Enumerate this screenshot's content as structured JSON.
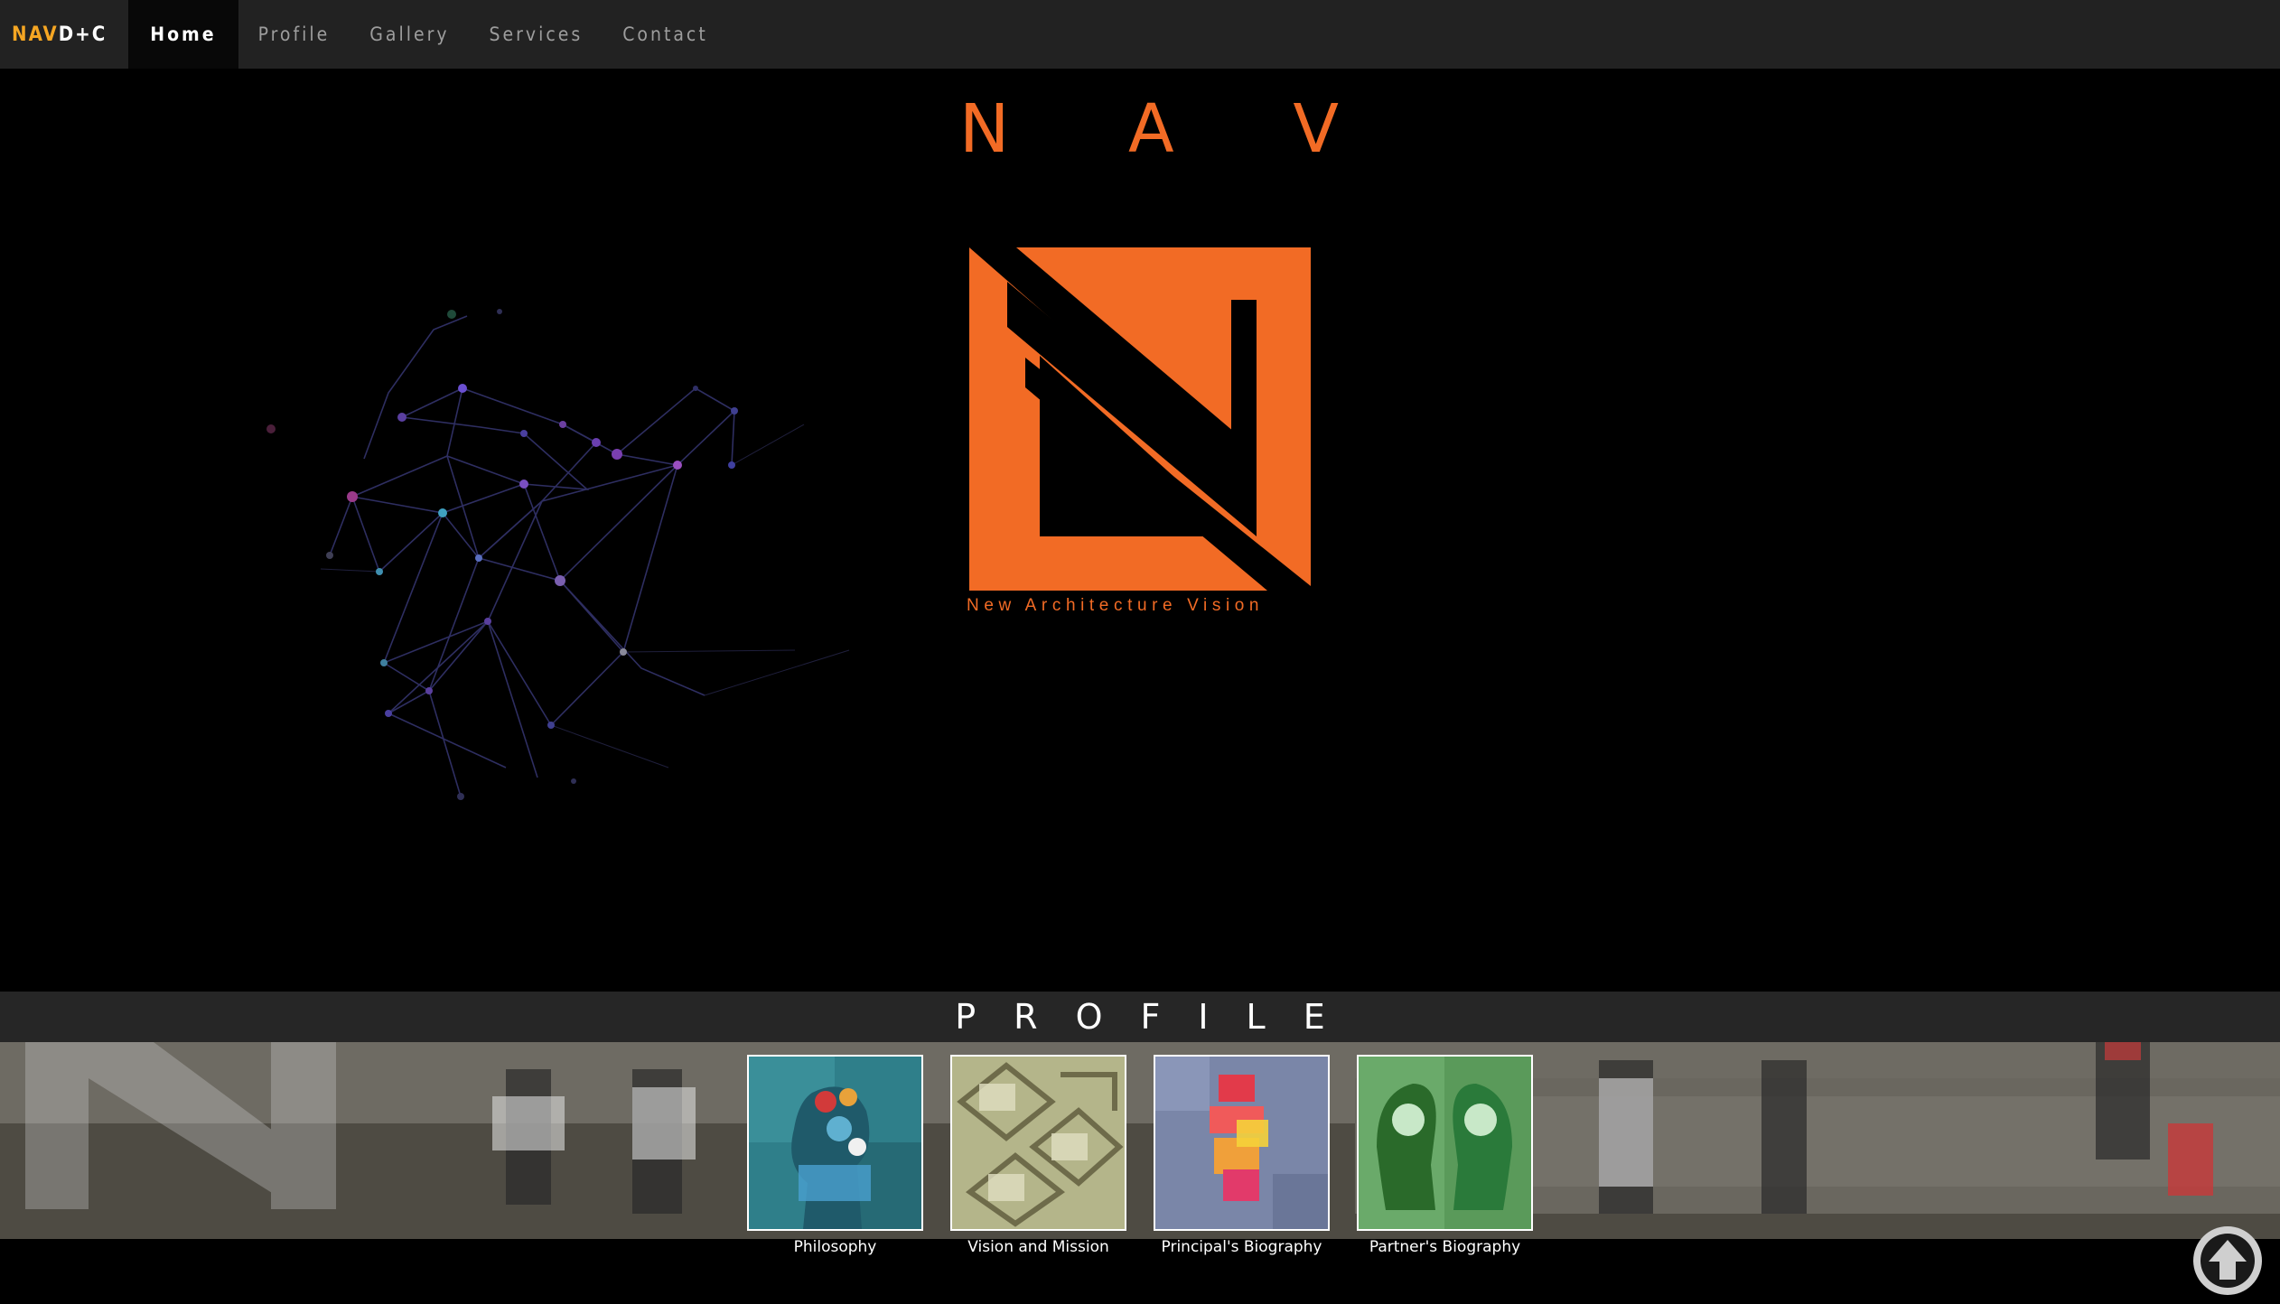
{
  "navbar": {
    "brand_part1": "NAV",
    "brand_part2": "D+C",
    "items": [
      {
        "label": "Home",
        "active": true
      },
      {
        "label": "Profile",
        "active": false
      },
      {
        "label": "Gallery",
        "active": false
      },
      {
        "label": "Services",
        "active": false
      },
      {
        "label": "Contact",
        "active": false
      }
    ]
  },
  "hero": {
    "title_letters": [
      "N",
      "A",
      "V"
    ],
    "tagline": "New Architecture Vision",
    "accent_color": "#f26b25"
  },
  "profile": {
    "title": "PROFILE",
    "cards": [
      {
        "label": "Philosophy"
      },
      {
        "label": "Vision and Mission"
      },
      {
        "label": "Principal's Biography"
      },
      {
        "label": "Partner's Biography"
      }
    ]
  },
  "controls": {
    "scroll_top_icon": "arrow-up-circle-icon"
  }
}
